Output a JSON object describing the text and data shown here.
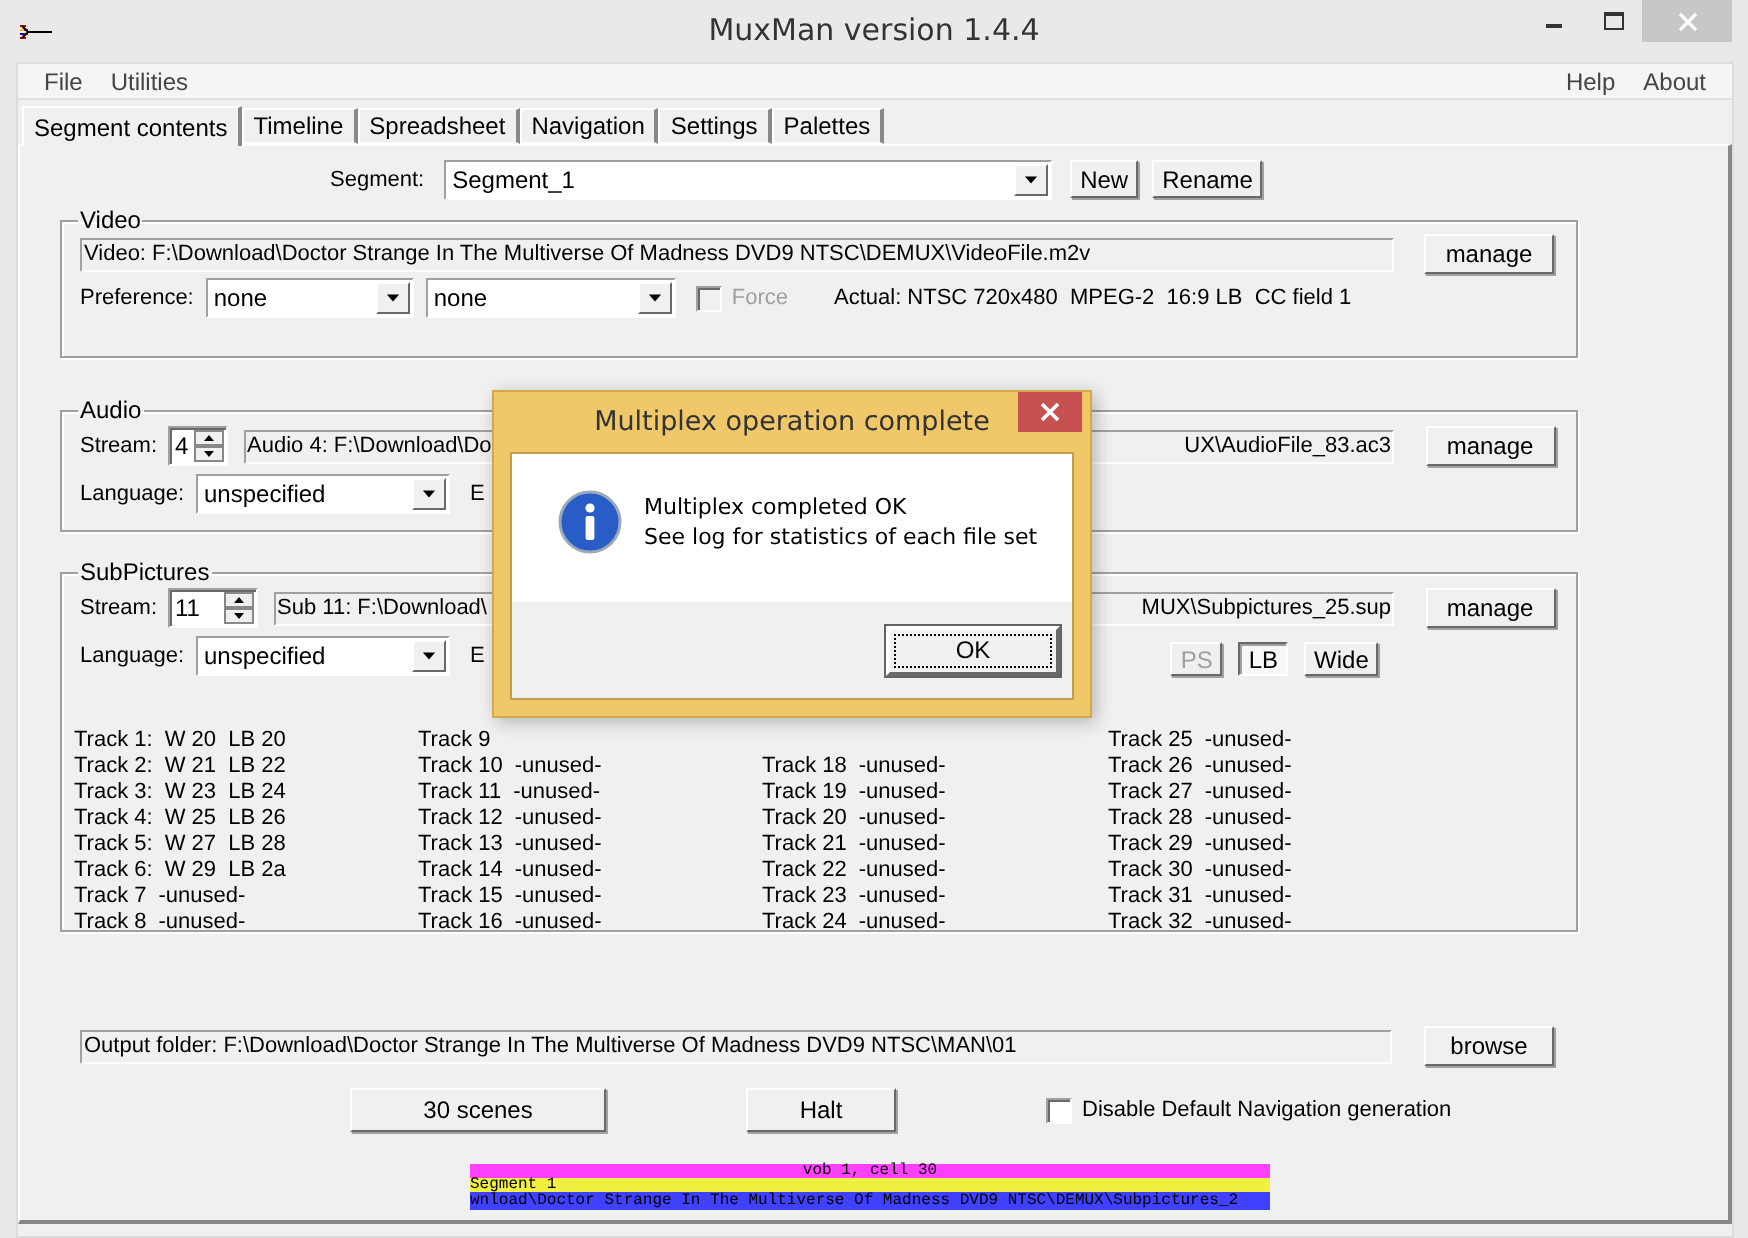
{
  "window": {
    "title": "MuxMan version 1.4.4"
  },
  "menu": {
    "left": [
      "File",
      "Utilities"
    ],
    "right": [
      "Help",
      "About"
    ]
  },
  "tabs": [
    {
      "label": "Segment contents",
      "selected": true
    },
    {
      "label": "Timeline",
      "selected": false
    },
    {
      "label": "Spreadsheet",
      "selected": false
    },
    {
      "label": "Navigation",
      "selected": false
    },
    {
      "label": "Settings",
      "selected": false
    },
    {
      "label": "Palettes",
      "selected": false
    }
  ],
  "segment": {
    "label": "Segment:",
    "value": "Segment_1",
    "buttons": [
      "New",
      "Rename"
    ]
  },
  "video": {
    "title": "Video",
    "file": "Video: F:\\Download\\Doctor Strange In The Multiverse Of Madness DVD9 NTSC\\DEMUX\\VideoFile.m2v",
    "button": "manage",
    "preference_label": "Preference:",
    "preference": [
      "none",
      "none"
    ],
    "force": {
      "label": "Force",
      "checked": false,
      "disabled": true
    },
    "actual": "Actual: NTSC 720x480  MPEG-2  16:9 LB  CC field 1"
  },
  "audio": {
    "title": "Audio",
    "stream_label": "Stream:",
    "stream": "4",
    "file_start": "Audio 4: F:\\Download\\Do",
    "file_end": "UX\\AudioFile_83.ac3",
    "button": "manage",
    "language_label": "Language:",
    "language": "unspecified",
    "label_2": "E"
  },
  "subpictures": {
    "title": "SubPictures",
    "stream_label": "Stream:",
    "stream": "11",
    "file_start": "Sub 11: F:\\Download\\",
    "file_end": "MUX\\Subpictures_25.sup",
    "button": "manage",
    "language_label": "Language:",
    "language": "unspecified",
    "label_2": "E",
    "aspect_buttons": [
      {
        "label": "PS",
        "disabled": true,
        "selected": false
      },
      {
        "label": "LB",
        "disabled": false,
        "selected": true
      },
      {
        "label": "Wide",
        "disabled": false,
        "selected": false
      }
    ],
    "track_columns": [
      [
        {
          "name": "Track 1:",
          "value": "W 20  LB 20"
        },
        {
          "name": "Track 2:",
          "value": "W 21  LB 22"
        },
        {
          "name": "Track 3:",
          "value": "W 23  LB 24"
        },
        {
          "name": "Track 4:",
          "value": "W 25  LB 26"
        },
        {
          "name": "Track 5:",
          "value": "W 27  LB 28"
        },
        {
          "name": "Track 6:",
          "value": "W 29  LB 2a"
        },
        {
          "name": "Track 7",
          "value": "-unused-"
        },
        {
          "name": "Track 8",
          "value": "-unused-"
        }
      ],
      [
        {
          "name": "Track 9"
        },
        {
          "name": "Track 10",
          "value": "-unused-"
        },
        {
          "name": "Track 11",
          "value": "-unused-"
        },
        {
          "name": "Track 12",
          "value": "-unused-"
        },
        {
          "name": "Track 13",
          "value": "-unused-"
        },
        {
          "name": "Track 14",
          "value": "-unused-"
        },
        {
          "name": "Track 15",
          "value": "-unused-"
        },
        {
          "name": "Track 16",
          "value": "-unused-"
        }
      ],
      [
        {
          "name": "Track 18",
          "value": "-unused-"
        },
        {
          "name": "Track 19",
          "value": "-unused-"
        },
        {
          "name": "Track 20",
          "value": "-unused-"
        },
        {
          "name": "Track 21",
          "value": "-unused-"
        },
        {
          "name": "Track 22",
          "value": "-unused-"
        },
        {
          "name": "Track 23",
          "value": "-unused-"
        },
        {
          "name": "Track 24",
          "value": "-unused-"
        }
      ],
      [
        {
          "name": "Track 25",
          "value": "-unused-"
        },
        {
          "name": "Track 26",
          "value": "-unused-"
        },
        {
          "name": "Track 27",
          "value": "-unused-"
        },
        {
          "name": "Track 28",
          "value": "-unused-"
        },
        {
          "name": "Track 29",
          "value": "-unused-"
        },
        {
          "name": "Track 30",
          "value": "-unused-"
        },
        {
          "name": "Track 31",
          "value": "-unused-"
        },
        {
          "name": "Track 32",
          "value": "-unused-"
        }
      ]
    ]
  },
  "output": {
    "text": "Output folder: F:\\Download\\Doctor Strange In The Multiverse Of Madness DVD9 NTSC\\MAN\\01",
    "button": "browse"
  },
  "actions": {
    "buttons": [
      "30 scenes",
      "Halt"
    ],
    "disable_nav": {
      "label": "Disable Default Navigation generation",
      "checked": false
    }
  },
  "progress": [
    {
      "kind": "centered",
      "text": "vob 1, cell 30",
      "color": "#ff40ff"
    },
    {
      "kind": "left",
      "text": "Segment 1",
      "color": "#f0f040"
    },
    {
      "kind": "left",
      "text": "wnload\\Doctor Strange In The Multiverse Of Madness DVD9 NTSC\\DEMUX\\Subpictures_2",
      "color": "#4040ff"
    }
  ],
  "dialog": {
    "title": "Multiplex operation complete",
    "lines": [
      "Multiplex completed OK",
      "See log for statistics of each file set"
    ],
    "button": "OK"
  }
}
